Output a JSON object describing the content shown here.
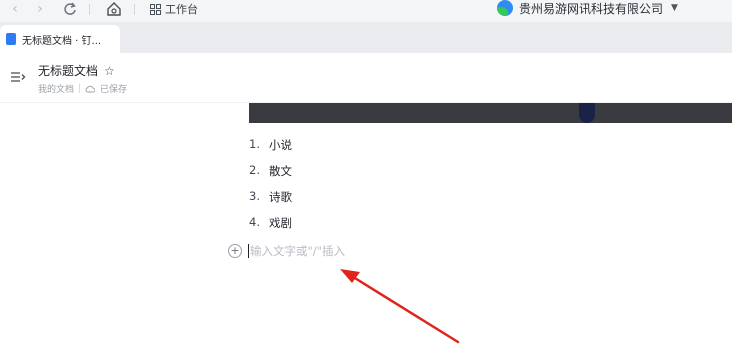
{
  "toolbar": {
    "workbench_label": "工作台",
    "org_name": "贵州易游网讯科技有限公司"
  },
  "tab": {
    "title": "无标题文档 · 钉..."
  },
  "document": {
    "title": "无标题文档",
    "location": "我的文档",
    "save_status": "已保存",
    "list": [
      {
        "number": "1.",
        "text": "小说"
      },
      {
        "number": "2.",
        "text": "散文"
      },
      {
        "number": "3.",
        "text": "诗歌"
      },
      {
        "number": "4.",
        "text": "戏剧"
      }
    ],
    "input_placeholder": "输入文字或\"/\"插入"
  },
  "colors": {
    "arrow": "#e0241b",
    "accent": "#2b7cf6"
  }
}
